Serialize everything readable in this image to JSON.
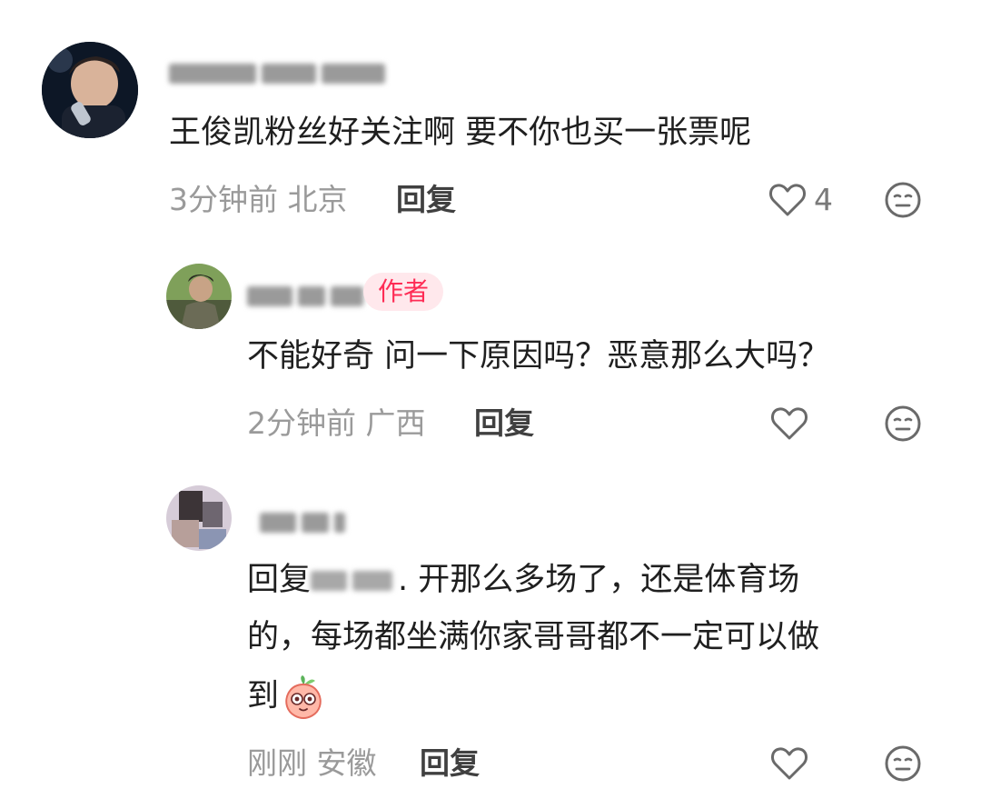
{
  "comments": [
    {
      "text": "王俊凯粉丝好关注啊 要不你也买一张票呢",
      "time": "3分钟前",
      "location": "北京",
      "reply_label": "回复",
      "likes": "4"
    },
    {
      "author_tag": "作者",
      "text": "不能好奇 问一下原因吗？恶意那么大吗？",
      "time": "2分钟前",
      "location": "广西",
      "reply_label": "回复"
    },
    {
      "reply_prefix": "回复",
      "text_line1_suffix": ". 开那么多场了，还是体育场",
      "text_line2": "的，每场都坐满你家哥哥都不一定可以做",
      "text_line3": "到",
      "time": "刚刚",
      "location": "安徽",
      "reply_label": "回复"
    }
  ],
  "icons": {
    "like": "heart-outline-icon",
    "dislike": "neutral-face-icon",
    "emoji": "peach-face-emoji"
  },
  "colors": {
    "author_tag_text": "#fe2c55",
    "author_tag_bg": "#ffe8ec",
    "meta_text": "#9a9a9a"
  }
}
